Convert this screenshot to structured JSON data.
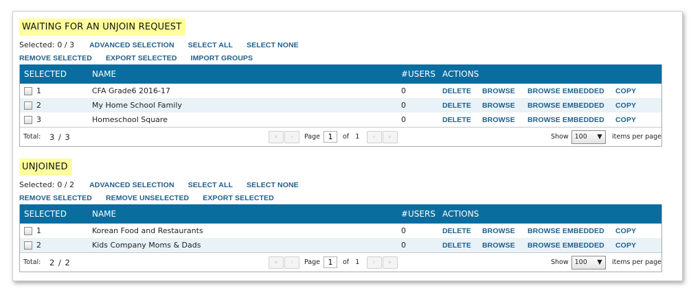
{
  "sections": [
    {
      "heading": "WAITING FOR AN UNJOIN REQUEST",
      "selected_label": "Selected:",
      "selected_count": "0 / 3",
      "links_row1": [
        "ADVANCED SELECTION",
        "SELECT ALL",
        "SELECT NONE"
      ],
      "links_row2": [
        "REMOVE SELECTED",
        "EXPORT SELECTED",
        "IMPORT GROUPS"
      ],
      "columns": [
        "SELECTED",
        "NAME",
        "#USERS",
        "ACTIONS"
      ],
      "rows": [
        {
          "num": "1",
          "name": "CFA Grade6 2016-17",
          "users": "0"
        },
        {
          "num": "2",
          "name": "My Home School Family",
          "users": "0"
        },
        {
          "num": "3",
          "name": "Homeschool Square",
          "users": "0"
        }
      ],
      "actions": [
        "DELETE",
        "BROWSE",
        "BROWSE EMBEDDED",
        "COPY"
      ],
      "pager": {
        "total_label": "Total:",
        "total_value": "3 / 3",
        "page_label": "Page",
        "page_value": "1",
        "of_label": "of",
        "page_count": "1",
        "show_label": "Show",
        "show_value": "100",
        "items_label": "items per page"
      }
    },
    {
      "heading": "UNJOINED",
      "selected_label": "Selected:",
      "selected_count": "0 / 2",
      "links_row1": [
        "ADVANCED SELECTION",
        "SELECT ALL",
        "SELECT NONE"
      ],
      "links_row2": [
        "REMOVE SELECTED",
        "REMOVE UNSELECTED",
        "EXPORT SELECTED"
      ],
      "columns": [
        "SELECTED",
        "NAME",
        "#USERS",
        "ACTIONS"
      ],
      "rows": [
        {
          "num": "1",
          "name": "Korean Food and Restaurants",
          "users": "0"
        },
        {
          "num": "2",
          "name": "Kids Company Moms & Dads",
          "users": "0"
        }
      ],
      "actions": [
        "DELETE",
        "BROWSE",
        "BROWSE EMBEDDED",
        "COPY"
      ],
      "pager": {
        "total_label": "Total:",
        "total_value": "2 / 2",
        "page_label": "Page",
        "page_value": "1",
        "of_label": "of",
        "page_count": "1",
        "show_label": "Show",
        "show_value": "100",
        "items_label": "items per page"
      }
    }
  ],
  "icons": {
    "first": "first-page-icon",
    "prev": "prev-page-icon",
    "next": "next-page-icon",
    "last": "last-page-icon",
    "dropdown": "chevron-down-icon"
  },
  "colors": {
    "header_bg": "#0a6da0",
    "link": "#1f5f8b",
    "heading_bg": "#fefe9e",
    "alt_row": "#e9f2f7"
  }
}
